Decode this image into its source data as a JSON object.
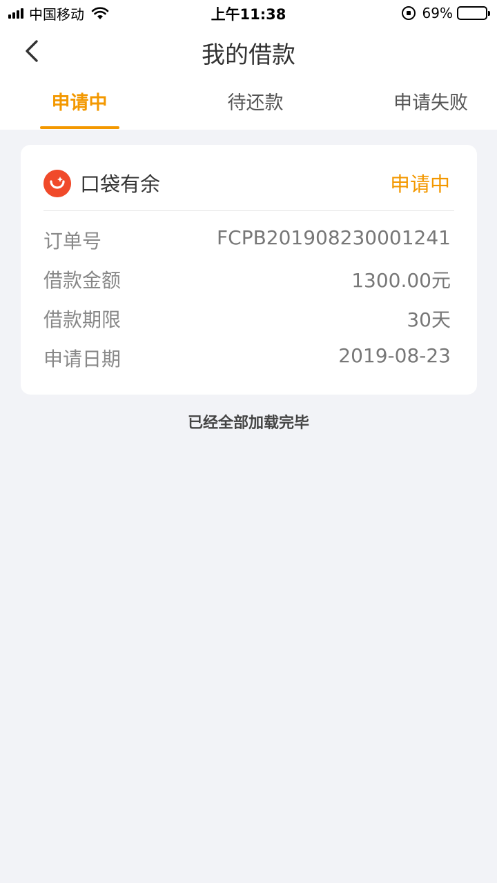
{
  "status_bar": {
    "carrier": "中国移动",
    "time": "上午11:38",
    "battery": "69%",
    "battery_level": 0.69
  },
  "nav": {
    "title": "我的借款",
    "back_icon": "chevron-left-icon"
  },
  "tabs": [
    {
      "label": "申请中",
      "active": true
    },
    {
      "label": "待还款",
      "active": false
    },
    {
      "label": "申请失败",
      "active": false
    }
  ],
  "loan": {
    "brand": "口袋有余",
    "status": "申请中",
    "rows": [
      {
        "label": "订单号",
        "value": "FCPB201908230001241"
      },
      {
        "label": "借款金额",
        "value": "1300.00元"
      },
      {
        "label": "借款期限",
        "value": "30天"
      },
      {
        "label": "申请日期",
        "value": "2019-08-23"
      }
    ]
  },
  "footer": "已经全部加载完毕",
  "colors": {
    "accent": "#f39800",
    "brand_logo": "#f04a2a",
    "background": "#f2f3f7"
  }
}
